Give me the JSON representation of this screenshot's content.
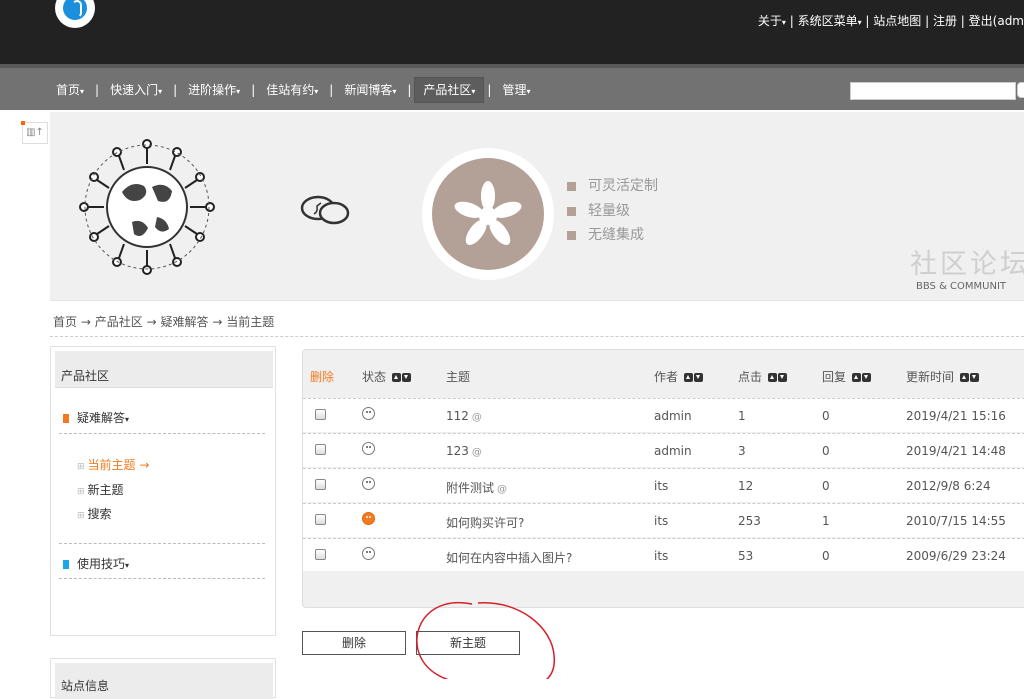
{
  "header": {
    "links": [
      {
        "label": "关于",
        "dropdown": true
      },
      {
        "label": "系统区菜单",
        "dropdown": true
      },
      {
        "label": "站点地图",
        "dropdown": false
      },
      {
        "label": "注册",
        "dropdown": false
      },
      {
        "label": "登出(adm",
        "dropdown": false
      }
    ]
  },
  "nav": {
    "items": [
      {
        "label": "首页",
        "active": false
      },
      {
        "label": "快速入门",
        "active": false
      },
      {
        "label": "进阶操作",
        "active": false
      },
      {
        "label": "佳站有约",
        "active": false
      },
      {
        "label": "新闻博客",
        "active": false
      },
      {
        "label": "产品社区",
        "active": true
      },
      {
        "label": "管理",
        "active": false
      }
    ],
    "search_value": ""
  },
  "banner": {
    "features": [
      "可灵活定制",
      "轻量级",
      "无缝集成"
    ],
    "brand_cn": "社区论坛",
    "brand_en": "BBS & COMMUNIT"
  },
  "breadcrumb": [
    "首页",
    "产品社区",
    "疑难解答",
    "当前主题"
  ],
  "sidebar": {
    "title": "产品社区",
    "categories": [
      {
        "label": "疑难解答",
        "color": "#f47a20"
      },
      {
        "label": "使用技巧",
        "color": "#1aa7e8"
      }
    ],
    "subitems": [
      {
        "label": "当前主题",
        "active": true
      },
      {
        "label": "新主题",
        "active": false
      },
      {
        "label": "搜索",
        "active": false
      }
    ],
    "second_title": "站点信息"
  },
  "table": {
    "headers": {
      "delete": "删除",
      "status": "状态",
      "topic": "主题",
      "author": "作者",
      "clicks": "点击",
      "replies": "回复",
      "updated": "更新时间"
    },
    "rows": [
      {
        "topic": "112",
        "attachment": true,
        "hot": false,
        "author": "admin",
        "clicks": "1",
        "replies": "0",
        "updated": "2019/4/21 15:16"
      },
      {
        "topic": "123",
        "attachment": true,
        "hot": false,
        "author": "admin",
        "clicks": "3",
        "replies": "0",
        "updated": "2019/4/21 14:48"
      },
      {
        "topic": "附件测试",
        "attachment": true,
        "hot": false,
        "author": "its",
        "clicks": "12",
        "replies": "0",
        "updated": "2012/9/8 6:24"
      },
      {
        "topic": "如何购买许可?",
        "attachment": false,
        "hot": true,
        "author": "its",
        "clicks": "253",
        "replies": "1",
        "updated": "2010/7/15 14:55"
      },
      {
        "topic": "如何在内容中插入图片?",
        "attachment": false,
        "hot": false,
        "author": "its",
        "clicks": "53",
        "replies": "0",
        "updated": "2009/6/29 23:24"
      }
    ]
  },
  "actions": {
    "delete_label": "删除",
    "new_topic_label": "新主题"
  },
  "colors": {
    "topbar": "#222222",
    "nav": "#727272",
    "accent_orange": "#f47a20",
    "accent_blue": "#1aa7e8",
    "banner_circle": "#b3a097",
    "annotation_red": "#d81e2a"
  }
}
